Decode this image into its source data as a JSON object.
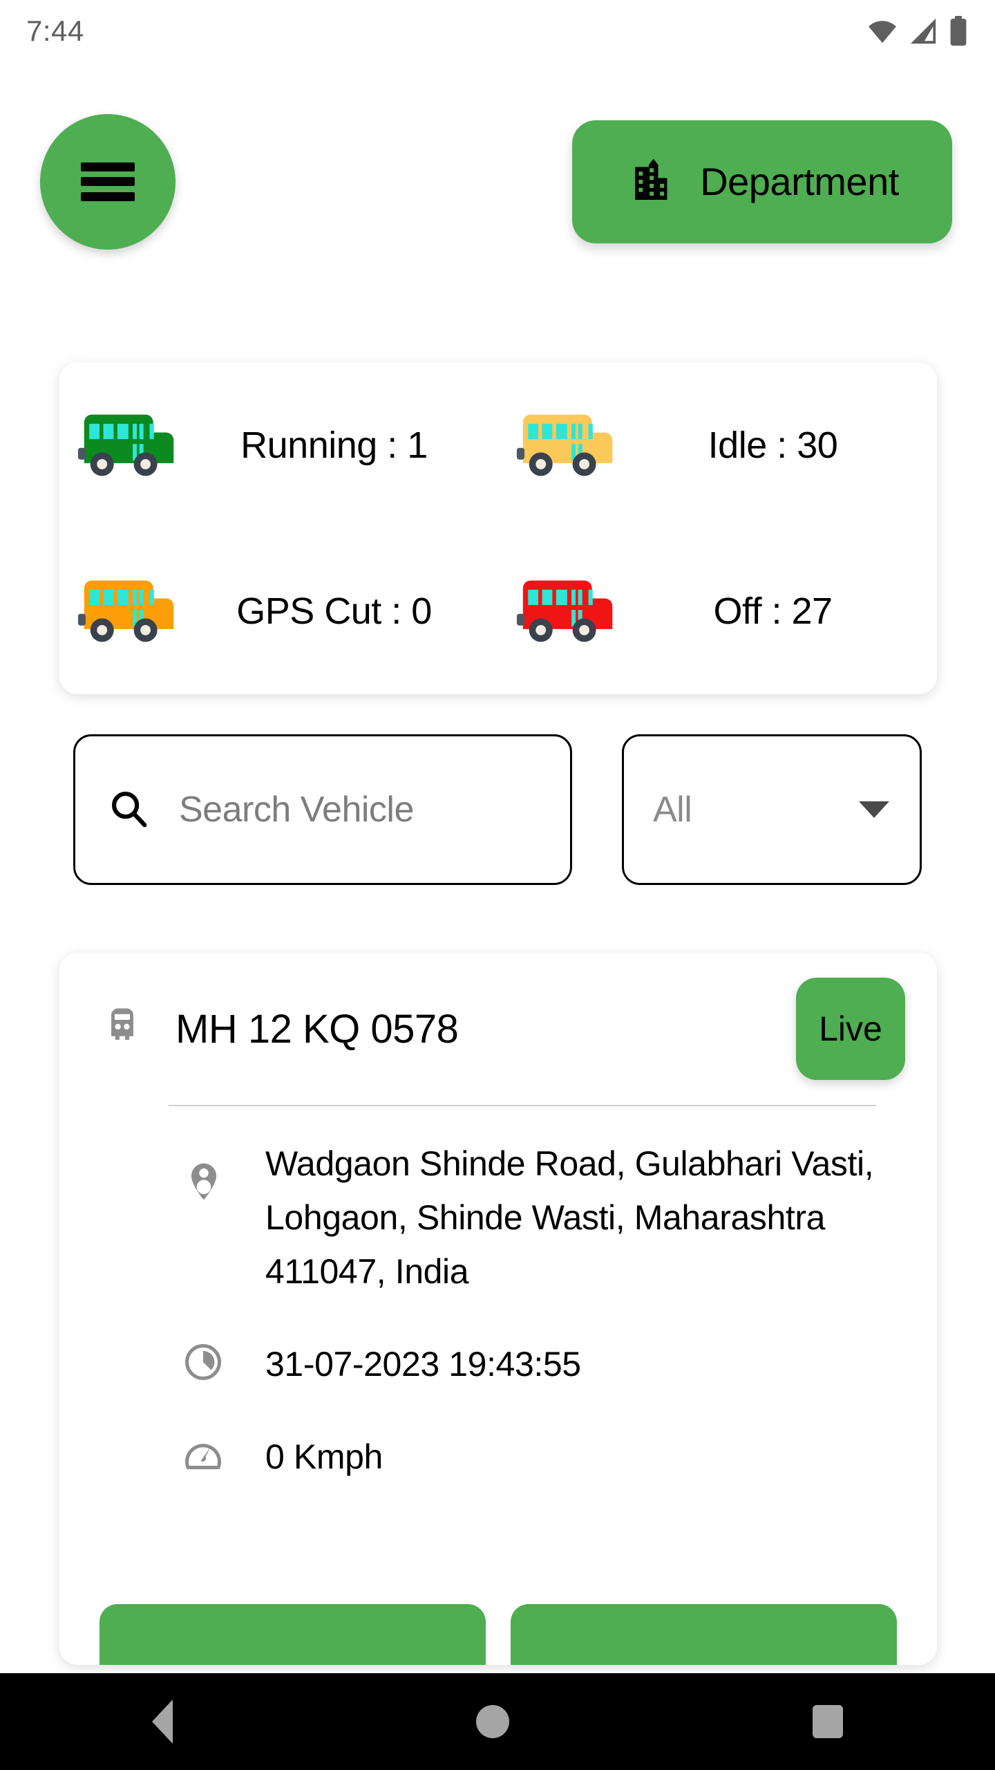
{
  "statusbar": {
    "clock": "7:44",
    "icons": [
      "wifi-icon",
      "cellular-signal-icon",
      "battery-icon"
    ]
  },
  "header": {
    "menu_icon": "hamburger-menu-icon",
    "department": {
      "label": "Department",
      "icon": "building-icon"
    }
  },
  "stats": {
    "items": [
      {
        "icon": "bus-icon-green",
        "color": "#0b8a20",
        "label": "Running : 1"
      },
      {
        "icon": "bus-icon-yellow",
        "color": "#fbc85a",
        "label": "Idle : 30"
      },
      {
        "icon": "bus-icon-orange",
        "color": "#fb9e08",
        "label": "GPS Cut : 0"
      },
      {
        "icon": "bus-icon-red",
        "color": "#f01414",
        "label": "Off : 27"
      }
    ]
  },
  "search": {
    "icon": "search-icon",
    "placeholder": "Search Vehicle",
    "value": ""
  },
  "filter": {
    "selected": "All",
    "icon": "chevron-down-icon"
  },
  "vehicle": {
    "icon": "bus-front-icon",
    "plate": "MH 12 KQ 0578",
    "status_label": "Live",
    "address_icon": "location-pin-icon",
    "address": "Wadgaon Shinde Road, Gulabhari Vasti, Lohgaon, Shinde Wasti, Maharashtra 411047, India",
    "time_icon": "clock-icon",
    "timestamp": "31-07-2023 19:43:55",
    "speed_icon": "speedometer-icon",
    "speed": "0 Kmph"
  },
  "navbar": {
    "back": "back-triangle-icon",
    "home": "home-circle-icon",
    "recents": "recents-square-icon"
  },
  "colors": {
    "accent_green": "#4eae51",
    "page_background": "#ffffff",
    "card_background": "#ffffff",
    "placeholder_text": "#7d7d7d"
  }
}
